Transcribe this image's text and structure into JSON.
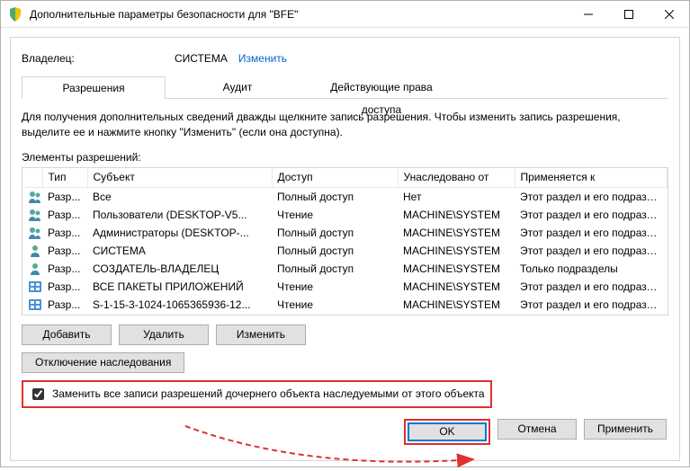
{
  "titlebar": {
    "title": "Дополнительные параметры безопасности  для \"BFE\""
  },
  "owner": {
    "label": "Владелец:",
    "value": "СИСТЕМА",
    "change": "Изменить"
  },
  "tabs": {
    "permissions": "Разрешения",
    "audit": "Аудит",
    "effective": "Действующие права доступа"
  },
  "description": "Для получения дополнительных сведений дважды щелкните запись разрешения. Чтобы изменить запись разрешения, выделите ее и нажмите кнопку \"Изменить\" (если она доступна).",
  "subheader": "Элементы разрешений:",
  "columns": {
    "type": "Тип",
    "subject": "Субъект",
    "access": "Доступ",
    "inherited": "Унаследовано от",
    "applies": "Применяется к"
  },
  "rows": [
    {
      "icon": "users",
      "type": "Разр...",
      "subject": "Все",
      "access": "Полный доступ",
      "inherited": "Нет",
      "applies": "Этот раздел и его подразделы"
    },
    {
      "icon": "users",
      "type": "Разр...",
      "subject": "Пользователи (DESKTOP-V5...",
      "access": "Чтение",
      "inherited": "MACHINE\\SYSTEM",
      "applies": "Этот раздел и его подразделы"
    },
    {
      "icon": "users",
      "type": "Разр...",
      "subject": "Администраторы (DESKTOP-...",
      "access": "Полный доступ",
      "inherited": "MACHINE\\SYSTEM",
      "applies": "Этот раздел и его подразделы"
    },
    {
      "icon": "user",
      "type": "Разр...",
      "subject": "СИСТЕМА",
      "access": "Полный доступ",
      "inherited": "MACHINE\\SYSTEM",
      "applies": "Этот раздел и его подразделы"
    },
    {
      "icon": "user",
      "type": "Разр...",
      "subject": "СОЗДАТЕЛЬ-ВЛАДЕЛЕЦ",
      "access": "Полный доступ",
      "inherited": "MACHINE\\SYSTEM",
      "applies": "Только подразделы"
    },
    {
      "icon": "app",
      "type": "Разр...",
      "subject": "ВСЕ ПАКЕТЫ ПРИЛОЖЕНИЙ",
      "access": "Чтение",
      "inherited": "MACHINE\\SYSTEM",
      "applies": "Этот раздел и его подразделы"
    },
    {
      "icon": "app",
      "type": "Разр...",
      "subject": "S-1-15-3-1024-1065365936-12...",
      "access": "Чтение",
      "inherited": "MACHINE\\SYSTEM",
      "applies": "Этот раздел и его подразделы"
    }
  ],
  "buttons": {
    "add": "Добавить",
    "remove": "Удалить",
    "edit": "Изменить",
    "disable_inherit": "Отключение наследования",
    "ok": "OK",
    "cancel": "Отмена",
    "apply": "Применить"
  },
  "checkbox": {
    "label": "Заменить все записи разрешений дочернего объекта наследуемыми от этого объекта"
  }
}
